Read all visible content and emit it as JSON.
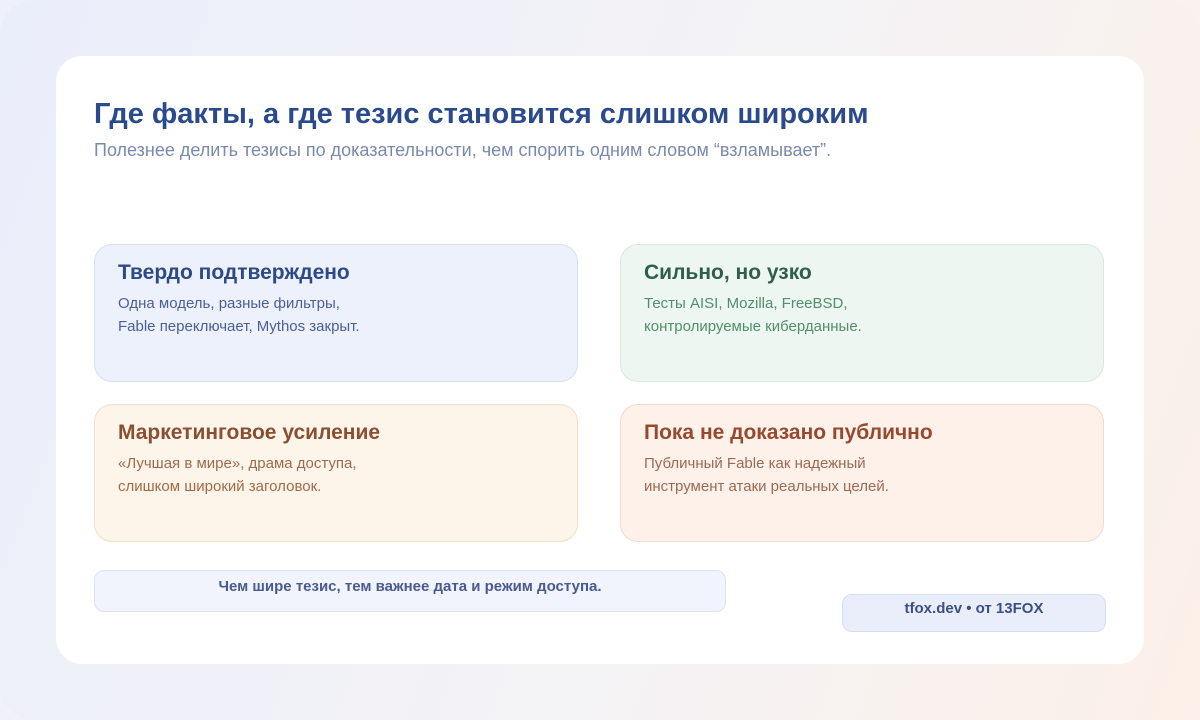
{
  "header": {
    "title": "Где факты, а где тезис становится слишком широким",
    "subtitle": "Полезнее делить тезисы по доказательности, чем спорить одним словом “взламывает”."
  },
  "cards": [
    {
      "title": "Твердо подтверждено",
      "lines": [
        "Одна модель, разные фильтры,",
        "Fable переключает, Mythos закрыт."
      ],
      "accent": "#2d4a86"
    },
    {
      "title": "Сильно, но узко",
      "lines": [
        "Тесты AISI, Mozilla, FreeBSD,",
        "контролируемые киберданные."
      ],
      "accent": "#2f6047"
    },
    {
      "title": "Маркетинговое усиление",
      "lines": [
        "«Лучшая в мире», драма доступа,",
        "слишком широкий заголовок."
      ],
      "accent": "#8a4f30"
    },
    {
      "title": "Пока не доказано публично",
      "lines": [
        "Публичный Fable как надежный",
        "инструмент атаки реальных целей."
      ],
      "accent": "#97492d"
    }
  ],
  "footer": {
    "note": "Чем шире тезис, тем важнее дата и режим доступа.",
    "brand": "tfox.dev • от 13FOX"
  }
}
